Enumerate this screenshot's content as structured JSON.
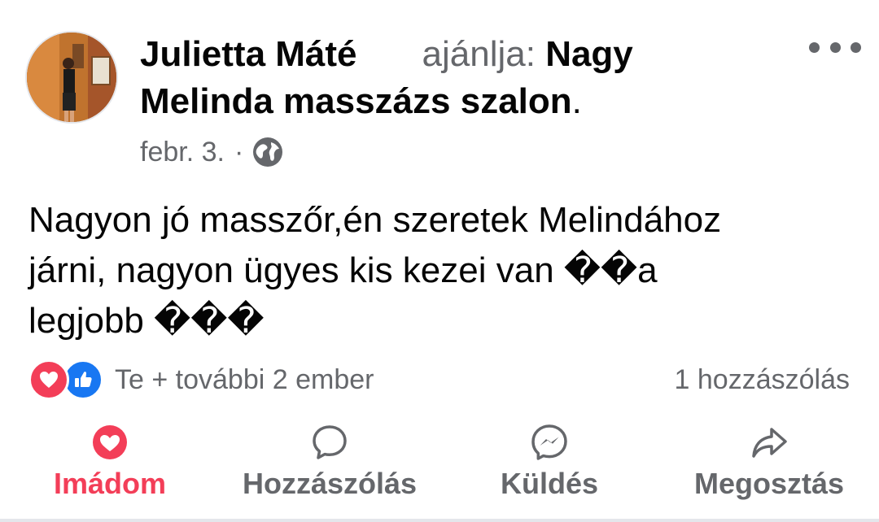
{
  "post": {
    "author": "Julietta Máté",
    "recommends_word": "ajánlja:",
    "page_name_line1": "Nagy",
    "page_name_line2": "Melinda masszázs szalon",
    "title_period": ".",
    "date": "febr. 3.",
    "separator": "·",
    "privacy_icon": "globe-icon",
    "more_icon": "more-options-icon",
    "text_lines": [
      "Nagyon jó masszőr,én szeretek Melindához",
      "járni, nagyon ügyes kis kezei van ��a",
      "legjobb ���"
    ]
  },
  "reactions": {
    "icons": [
      "love-reaction-icon",
      "like-reaction-icon"
    ],
    "summary": "Te + további 2 ember",
    "comments_count": "1 hozzászólás"
  },
  "actions": [
    {
      "label": "Imádom",
      "icon": "heart-icon",
      "color": "#f33e58"
    },
    {
      "label": "Hozzászólás",
      "icon": "comment-icon",
      "color": "#65676b"
    },
    {
      "label": "Küldés",
      "icon": "messenger-icon",
      "color": "#65676b"
    },
    {
      "label": "Megosztás",
      "icon": "share-icon",
      "color": "#65676b"
    }
  ],
  "colors": {
    "text_primary": "#050505",
    "text_secondary": "#65676b",
    "love_red": "#f33e58",
    "like_blue": "#1877f2"
  }
}
